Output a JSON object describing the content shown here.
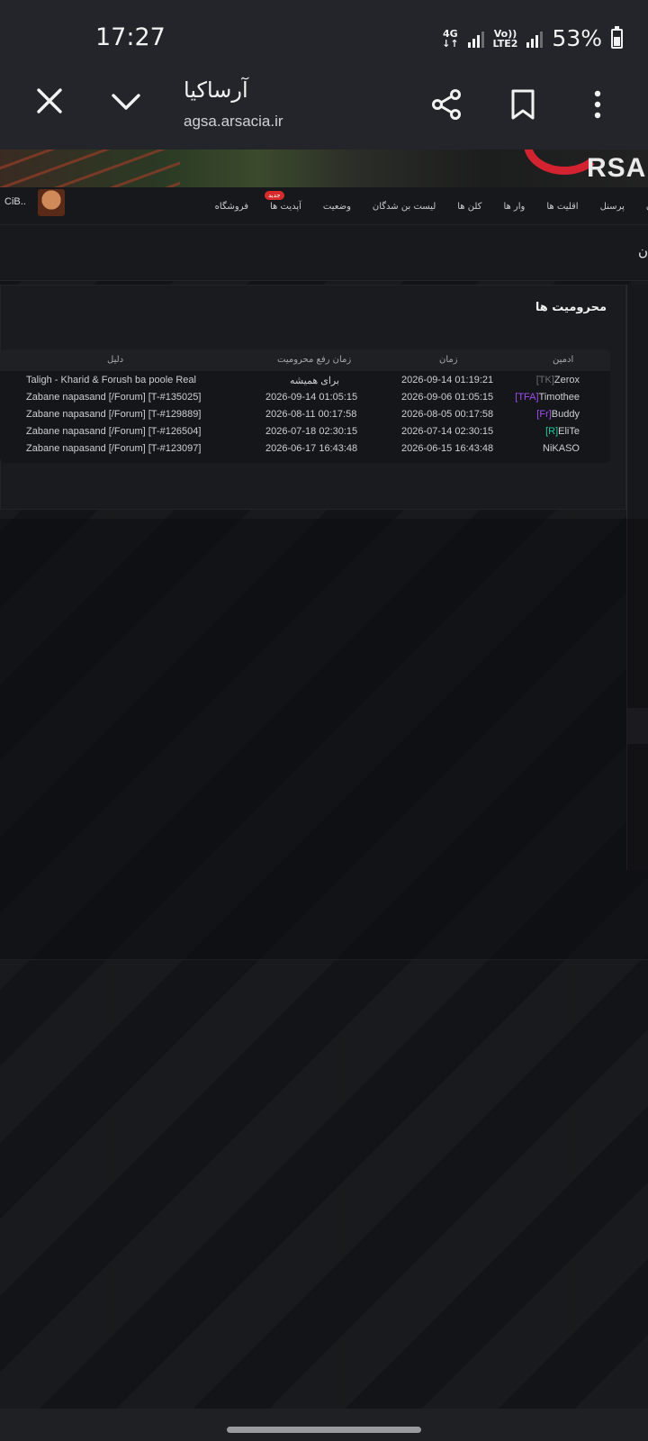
{
  "status_bar": {
    "time": "17:27",
    "network_top": "4G",
    "network_bottom": "↓↑",
    "volte_top": "Vo))",
    "volte_bottom": "LTE2",
    "battery_percent": "53%",
    "battery_level": 0.53
  },
  "browser": {
    "title": "آرساکیا",
    "url": "agsa.arsacia.ir"
  },
  "site": {
    "logo_text": "RSA",
    "user_name": "CiB..",
    "menu": [
      {
        "label": "ان"
      },
      {
        "label": "پرسنل"
      },
      {
        "label": "اقلیت ها"
      },
      {
        "label": "وار ها"
      },
      {
        "label": "کلن ها"
      },
      {
        "label": "لیست بن شدگان"
      },
      {
        "label": "وضعیت"
      },
      {
        "label": "آپدیت ها",
        "badge": "جدید"
      },
      {
        "label": "فروشگاه"
      }
    ],
    "section_title": "ن",
    "panel_title": "محرومیت ها",
    "table": {
      "headers": {
        "admin": "ادمین",
        "time": "زمان",
        "lift_time": "زمان رفع محرومیت",
        "reason": "دلیل"
      },
      "rows": [
        {
          "admin_tag": "[TK]",
          "admin_name": "Zerox",
          "tag_color": "grey",
          "time": "2026-09-14 01:19:21",
          "lift_time": "برای همیشه",
          "reason": "Taligh - Kharid & Forush ba poole Real"
        },
        {
          "admin_tag": "[TFA]",
          "admin_name": "Timothee",
          "tag_color": "purple",
          "time": "2026-09-06 01:05:15",
          "lift_time": "2026-09-14 01:05:15",
          "reason": "Zabane napasand [/Forum] [T-#135025]"
        },
        {
          "admin_tag": "[Fr]",
          "admin_name": "Buddy",
          "tag_color": "purple",
          "time": "2026-08-05 00:17:58",
          "lift_time": "2026-08-11 00:17:58",
          "reason": "Zabane napasand [/Forum] [T-#129889]"
        },
        {
          "admin_tag": "[R]",
          "admin_name": "EliTe",
          "tag_color": "green",
          "time": "2026-07-14 02:30:15",
          "lift_time": "2026-07-18 02:30:15",
          "reason": "Zabane napasand [/Forum] [T-#126504]"
        },
        {
          "admin_tag": "",
          "admin_name": "NiKASO",
          "tag_color": "grey",
          "time": "2026-06-15 16:43:48",
          "lift_time": "2026-06-17 16:43:48",
          "reason": "Zabane napasand [/Forum] [T-#123097]"
        }
      ]
    }
  }
}
